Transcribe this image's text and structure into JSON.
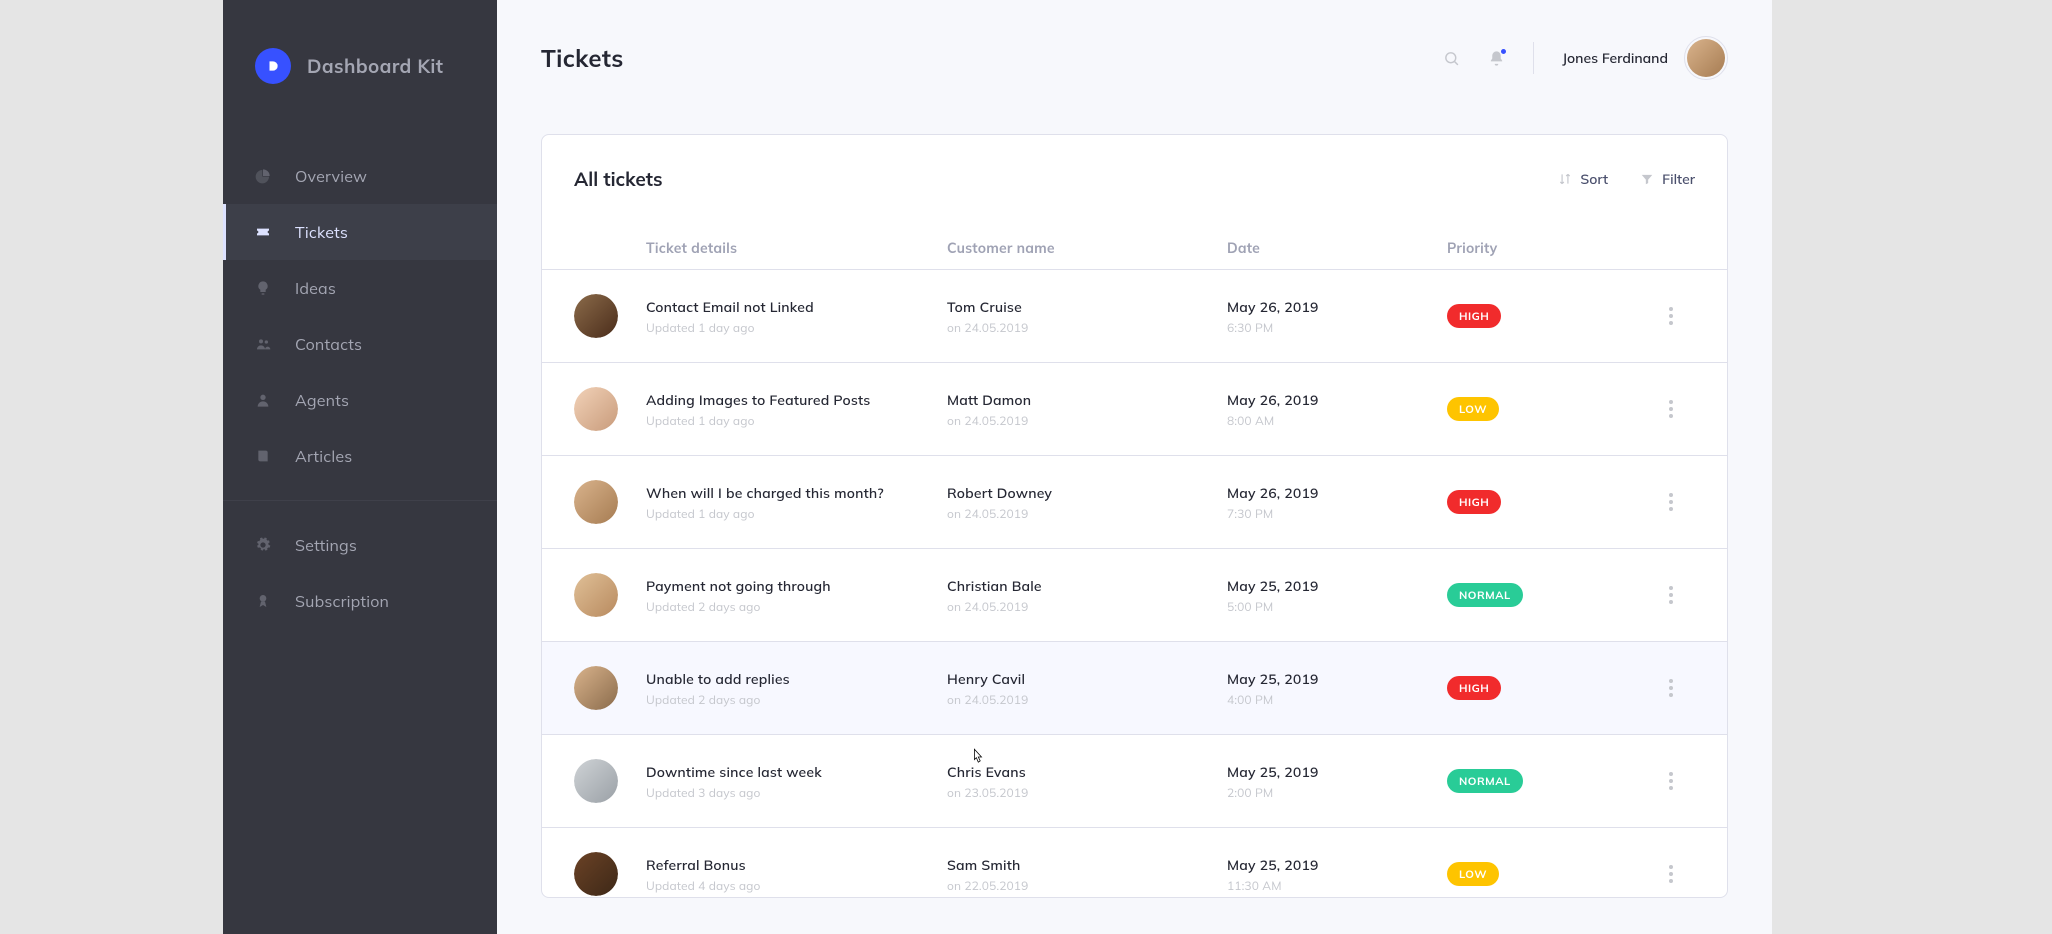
{
  "brand": {
    "name": "Dashboard Kit"
  },
  "sidebar": {
    "items": [
      {
        "label": "Overview",
        "icon": "pie-chart-icon"
      },
      {
        "label": "Tickets",
        "icon": "ticket-icon",
        "active": true
      },
      {
        "label": "Ideas",
        "icon": "lightbulb-icon"
      },
      {
        "label": "Contacts",
        "icon": "people-icon"
      },
      {
        "label": "Agents",
        "icon": "agent-icon"
      },
      {
        "label": "Articles",
        "icon": "book-icon"
      }
    ],
    "secondary_items": [
      {
        "label": "Settings",
        "icon": "gear-icon"
      },
      {
        "label": "Subscription",
        "icon": "badge-icon"
      }
    ]
  },
  "header": {
    "page_title": "Tickets",
    "user_name": "Jones Ferdinand"
  },
  "card": {
    "title": "All tickets",
    "sort_label": "Sort",
    "filter_label": "Filter"
  },
  "columns": {
    "details": "Ticket details",
    "customer": "Customer name",
    "date": "Date",
    "priority": "Priority"
  },
  "tickets": [
    {
      "title": "Contact Email not Linked",
      "updated": "Updated 1 day ago",
      "customer": "Tom Cruise",
      "customer_sub": "on 24.05.2019",
      "date": "May 26, 2019",
      "time": "6:30 PM",
      "priority": "HIGH",
      "priority_class": "high",
      "avatar_color": "linear-gradient(135deg,#8b6b4a,#4a2c1a)"
    },
    {
      "title": "Adding Images to Featured Posts",
      "updated": "Updated 1 day ago",
      "customer": "Matt Damon",
      "customer_sub": "on 24.05.2019",
      "date": "May 26, 2019",
      "time": "8:00 AM",
      "priority": "LOW",
      "priority_class": "low",
      "avatar_color": "linear-gradient(135deg,#f2d2b8,#c89b7b)"
    },
    {
      "title": "When will I be charged this month?",
      "updated": "Updated 1 day ago",
      "customer": "Robert Downey",
      "customer_sub": "on 24.05.2019",
      "date": "May 26, 2019",
      "time": "7:30 PM",
      "priority": "HIGH",
      "priority_class": "high",
      "avatar_color": "linear-gradient(135deg,#d9b38c,#a67c52)"
    },
    {
      "title": "Payment not going through",
      "updated": "Updated 2 days ago",
      "customer": "Christian Bale",
      "customer_sub": "on 24.05.2019",
      "date": "May 25, 2019",
      "time": "5:00 PM",
      "priority": "NORMAL",
      "priority_class": "normal",
      "avatar_color": "linear-gradient(135deg,#e0c097,#b88a5f)"
    },
    {
      "title": "Unable to add replies",
      "updated": "Updated 2 days ago",
      "customer": "Henry Cavil",
      "customer_sub": "on 24.05.2019",
      "date": "May 25, 2019",
      "time": "4:00 PM",
      "priority": "HIGH",
      "priority_class": "high",
      "avatar_color": "linear-gradient(135deg,#d9b38c,#8a6b4b)",
      "hovered": true
    },
    {
      "title": "Downtime since last week",
      "updated": "Updated 3 days ago",
      "customer": "Chris Evans",
      "customer_sub": "on 23.05.2019",
      "date": "May 25, 2019",
      "time": "2:00 PM",
      "priority": "NORMAL",
      "priority_class": "normal",
      "avatar_color": "linear-gradient(135deg,#cfd3d6,#9aa0a6)"
    },
    {
      "title": "Referral Bonus",
      "updated": "Updated 4 days ago",
      "customer": "Sam Smith",
      "customer_sub": "on 22.05.2019",
      "date": "May 25, 2019",
      "time": "11:30 AM",
      "priority": "LOW",
      "priority_class": "low",
      "avatar_color": "linear-gradient(135deg,#6b4226,#3d2817)"
    }
  ]
}
